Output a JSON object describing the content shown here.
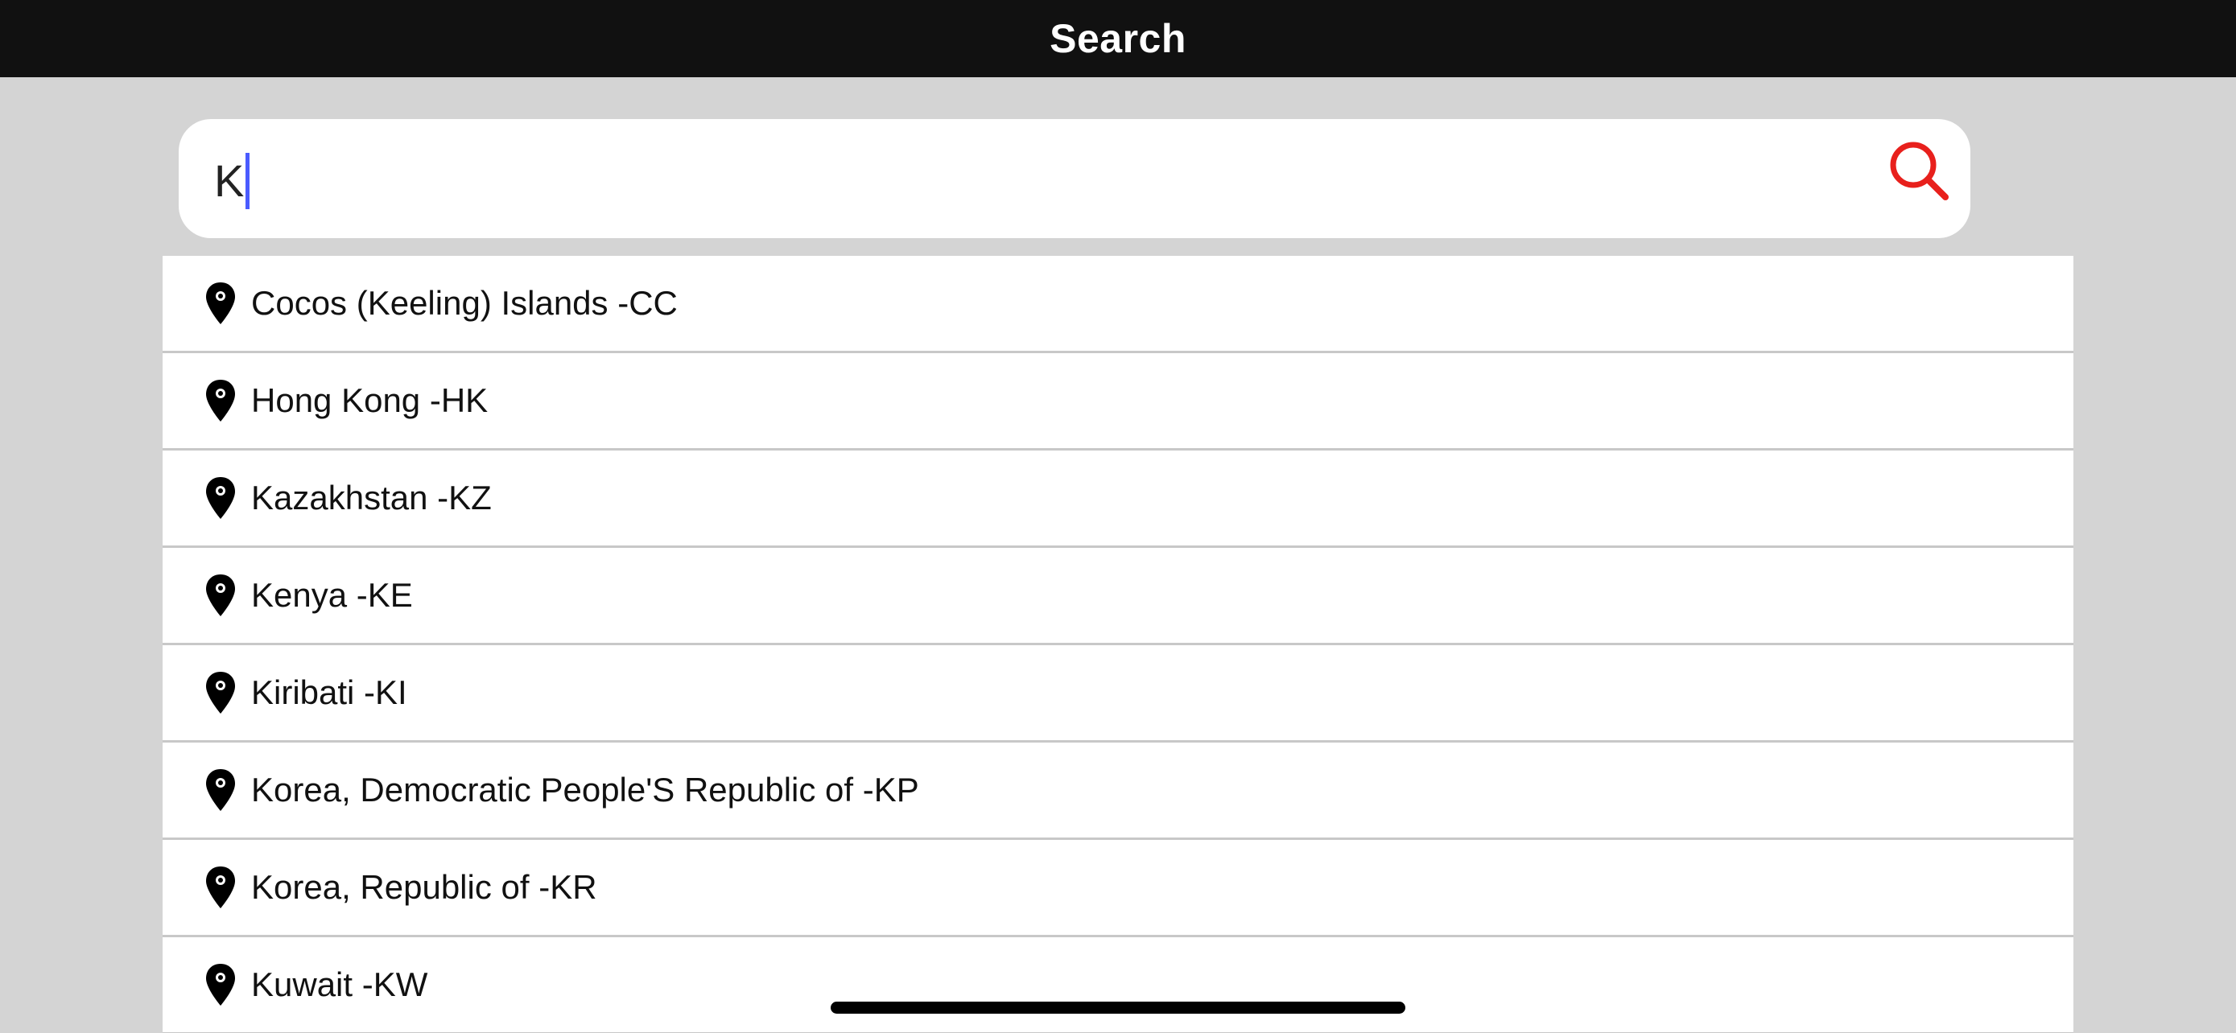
{
  "header": {
    "title": "Search"
  },
  "search": {
    "value": "K"
  },
  "icons": {
    "search": "search-icon",
    "result": "map-pin-icon"
  },
  "colors": {
    "header_bg": "#111111",
    "search_icon": "#e8201c",
    "caret": "#4a5bff",
    "page_bg": "#d4d4d4"
  },
  "results": [
    {
      "label": "Cocos (Keeling) Islands -CC"
    },
    {
      "label": "Hong Kong -HK"
    },
    {
      "label": "Kazakhstan -KZ"
    },
    {
      "label": "Kenya -KE"
    },
    {
      "label": "Kiribati -KI"
    },
    {
      "label": "Korea, Democratic People'S Republic of -KP"
    },
    {
      "label": "Korea, Republic of -KR"
    },
    {
      "label": "Kuwait -KW"
    }
  ]
}
